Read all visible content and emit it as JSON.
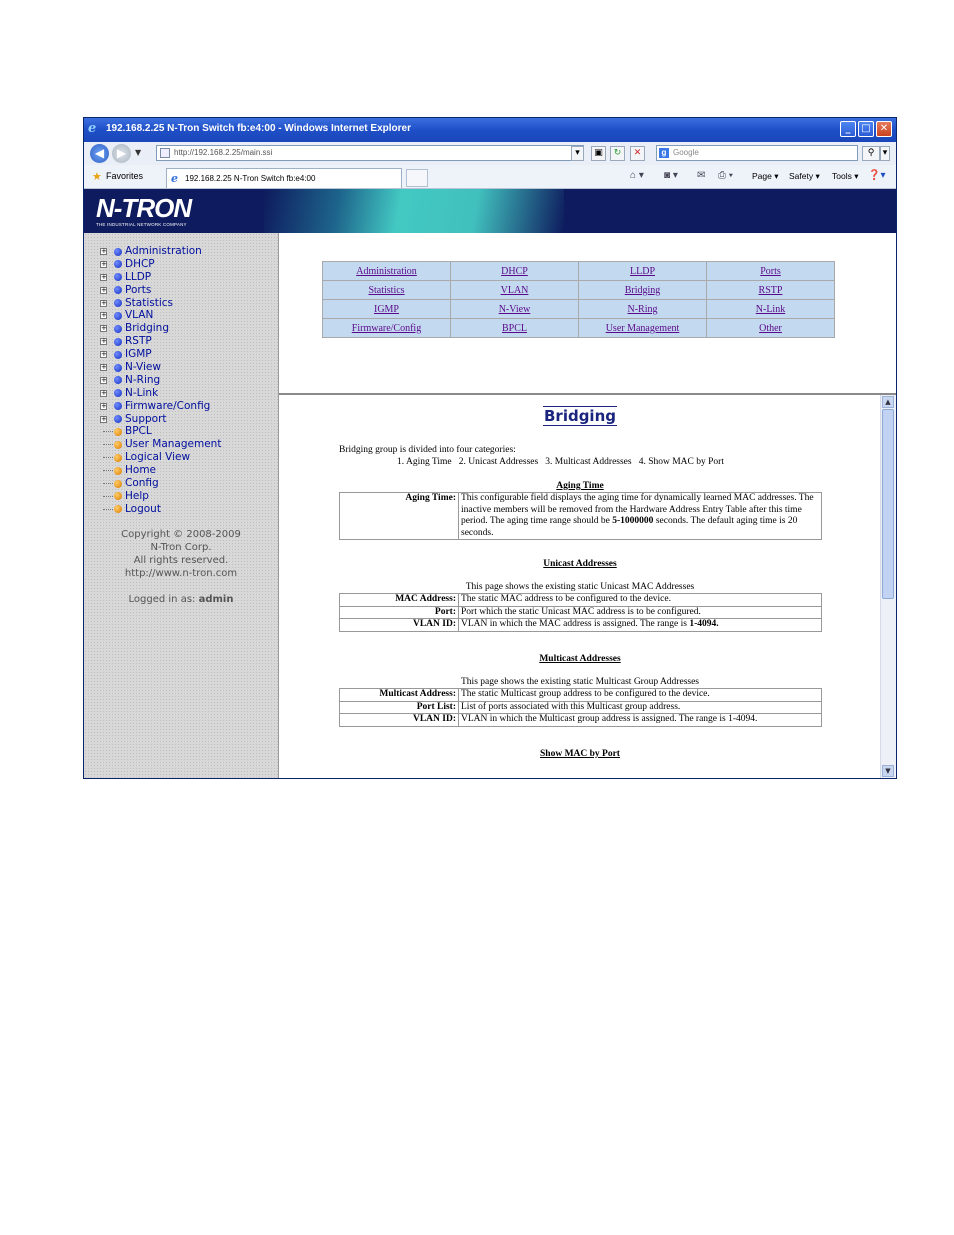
{
  "window": {
    "title": "192.168.2.25 N-Tron Switch fb:e4:00 - Windows Internet Explorer",
    "url": "http://192.168.2.25/main.ssi",
    "search_placeholder": "Google",
    "favorites_label": "Favorites",
    "tab_label": "192.168.2.25 N-Tron Switch fb:e4:00",
    "commands": {
      "page": "Page ▾",
      "safety": "Safety ▾",
      "tools": "Tools ▾"
    }
  },
  "banner": {
    "logo": "N-TRON",
    "tagline": "THE INDUSTRIAL NETWORK COMPANY"
  },
  "sidebar": {
    "folders": [
      "Administration",
      "DHCP",
      "LLDP",
      "Ports",
      "Statistics",
      "VLAN",
      "Bridging",
      "RSTP",
      "IGMP",
      "N-View",
      "N-Ring",
      "N-Link",
      "Firmware/Config",
      "Support"
    ],
    "pages": [
      "BPCL",
      "User Management",
      "Logical View",
      "Home",
      "Config",
      "Help",
      "Logout"
    ],
    "copyright": "Copyright © 2008-2009",
    "company": "N-Tron Corp.",
    "rights": "All rights reserved.",
    "website": "http://www.n-tron.com",
    "logged_in_label": "Logged in as:",
    "logged_in_user": "admin"
  },
  "menu": [
    [
      "Administration",
      "DHCP",
      "LLDP",
      "Ports"
    ],
    [
      "Statistics",
      "VLAN",
      "Bridging",
      "RSTP"
    ],
    [
      "IGMP",
      "N-View",
      "N-Ring",
      "N-Link"
    ],
    [
      "Firmware/Config",
      "BPCL",
      "User Management",
      "Other"
    ]
  ],
  "doc": {
    "title": "Bridging",
    "intro": "Bridging group is divided into four categories:",
    "categories": "1. Aging Time   2. Unicast Addresses   3. Multicast Addresses   4. Show MAC by Port",
    "aging": {
      "heading": "Aging Time",
      "key": "Aging Time:",
      "desc_a": "This configurable field displays the aging time for dynamically learned MAC addresses. The inactive members will be removed from the Hardware Address Entry Table after this time period. The aging time range should be ",
      "desc_bold": "5-1000000",
      "desc_b": " seconds. The default aging time is 20 seconds."
    },
    "unicast": {
      "heading": "Unicast Addresses",
      "intro": "This page shows the existing static Unicast MAC Addresses",
      "rows": [
        {
          "k": "MAC Address:",
          "v": "The static MAC address to be configured to the device."
        },
        {
          "k": "Port:",
          "v": "Port which the static Unicast MAC address is to be configured."
        },
        {
          "k": "VLAN ID:",
          "v": "VLAN in which the MAC address is assigned. The range is ",
          "b": "1-4094."
        }
      ]
    },
    "multicast": {
      "heading": "Multicast Addresses",
      "intro": "This page shows the existing static Multicast Group Addresses",
      "rows": [
        {
          "k": "Multicast Address:",
          "v": "The static Multicast group address to be configured to the device."
        },
        {
          "k": "Port List:",
          "v": "List of ports associated with this Multicast group address."
        },
        {
          "k": "VLAN ID:",
          "v": "VLAN in which the Multicast group address is assigned. The range is 1-4094."
        }
      ]
    },
    "showmac": {
      "heading": "Show MAC by Port"
    }
  }
}
